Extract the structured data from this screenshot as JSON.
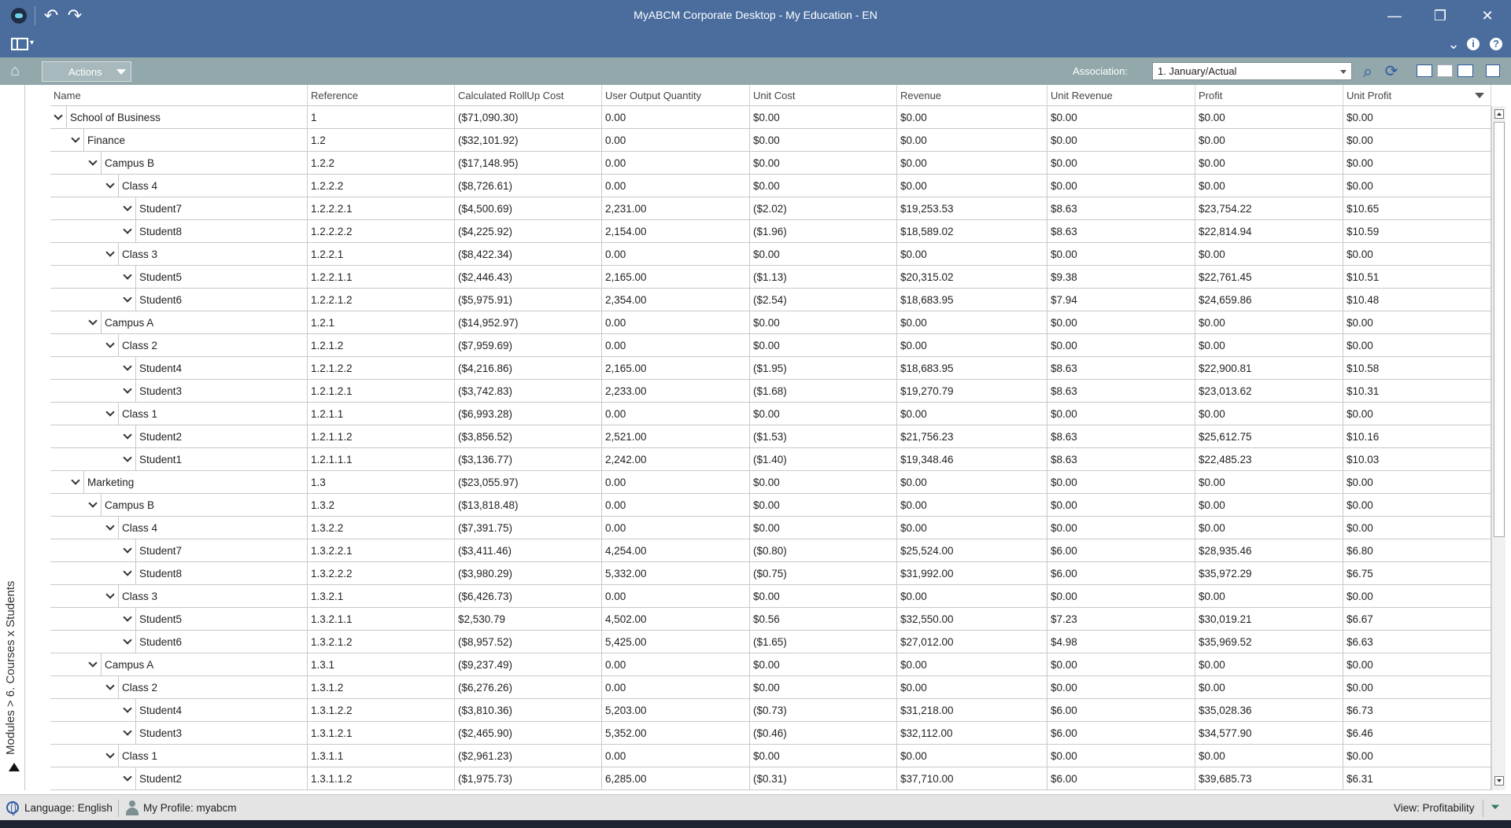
{
  "window": {
    "title": "MyABCM Corporate Desktop - My Education - EN",
    "minimize_glyph": "—",
    "restore_glyph": "❐",
    "close_glyph": "✕",
    "undo_glyph": "↶",
    "redo_glyph": "↷"
  },
  "ribbon": {
    "dropdown_glyph": "▾",
    "collapse_glyph": "⌄",
    "info_glyph": "i",
    "help_glyph": "?"
  },
  "toolbar": {
    "home_glyph": "⌂",
    "actions_label": "Actions",
    "association_label": "Association:",
    "association_value": "1. January/Actual",
    "search_glyph": "⌕",
    "refresh_glyph": "⟳"
  },
  "side_panel": {
    "breadcrumb": "Modules > 6. Courses x Students"
  },
  "grid": {
    "columns": [
      "Name",
      "Reference",
      "Calculated RollUp Cost",
      "User Output Quantity",
      "Unit Cost",
      "Revenue",
      "Unit Revenue",
      "Profit",
      "Unit Profit"
    ],
    "rows": [
      {
        "level": 0,
        "name": "School of Business",
        "ref": "1",
        "cost": "($71,090.30)",
        "qty": "0.00",
        "unit_cost": "$0.00",
        "revenue": "$0.00",
        "unit_revenue": "$0.00",
        "profit": "$0.00",
        "unit_profit": "$0.00"
      },
      {
        "level": 1,
        "name": "Finance",
        "ref": "1.2",
        "cost": "($32,101.92)",
        "qty": "0.00",
        "unit_cost": "$0.00",
        "revenue": "$0.00",
        "unit_revenue": "$0.00",
        "profit": "$0.00",
        "unit_profit": "$0.00"
      },
      {
        "level": 2,
        "name": "Campus B",
        "ref": "1.2.2",
        "cost": "($17,148.95)",
        "qty": "0.00",
        "unit_cost": "$0.00",
        "revenue": "$0.00",
        "unit_revenue": "$0.00",
        "profit": "$0.00",
        "unit_profit": "$0.00"
      },
      {
        "level": 3,
        "name": "Class 4",
        "ref": "1.2.2.2",
        "cost": "($8,726.61)",
        "qty": "0.00",
        "unit_cost": "$0.00",
        "revenue": "$0.00",
        "unit_revenue": "$0.00",
        "profit": "$0.00",
        "unit_profit": "$0.00"
      },
      {
        "level": 4,
        "name": "Student7",
        "ref": "1.2.2.2.1",
        "cost": "($4,500.69)",
        "qty": "2,231.00",
        "unit_cost": "($2.02)",
        "revenue": "$19,253.53",
        "unit_revenue": "$8.63",
        "profit": "$23,754.22",
        "unit_profit": "$10.65"
      },
      {
        "level": 4,
        "name": "Student8",
        "ref": "1.2.2.2.2",
        "cost": "($4,225.92)",
        "qty": "2,154.00",
        "unit_cost": "($1.96)",
        "revenue": "$18,589.02",
        "unit_revenue": "$8.63",
        "profit": "$22,814.94",
        "unit_profit": "$10.59"
      },
      {
        "level": 3,
        "name": "Class 3",
        "ref": "1.2.2.1",
        "cost": "($8,422.34)",
        "qty": "0.00",
        "unit_cost": "$0.00",
        "revenue": "$0.00",
        "unit_revenue": "$0.00",
        "profit": "$0.00",
        "unit_profit": "$0.00"
      },
      {
        "level": 4,
        "name": "Student5",
        "ref": "1.2.2.1.1",
        "cost": "($2,446.43)",
        "qty": "2,165.00",
        "unit_cost": "($1.13)",
        "revenue": "$20,315.02",
        "unit_revenue": "$9.38",
        "profit": "$22,761.45",
        "unit_profit": "$10.51"
      },
      {
        "level": 4,
        "name": "Student6",
        "ref": "1.2.2.1.2",
        "cost": "($5,975.91)",
        "qty": "2,354.00",
        "unit_cost": "($2.54)",
        "revenue": "$18,683.95",
        "unit_revenue": "$7.94",
        "profit": "$24,659.86",
        "unit_profit": "$10.48"
      },
      {
        "level": 2,
        "name": "Campus A",
        "ref": "1.2.1",
        "cost": "($14,952.97)",
        "qty": "0.00",
        "unit_cost": "$0.00",
        "revenue": "$0.00",
        "unit_revenue": "$0.00",
        "profit": "$0.00",
        "unit_profit": "$0.00"
      },
      {
        "level": 3,
        "name": "Class 2",
        "ref": "1.2.1.2",
        "cost": "($7,959.69)",
        "qty": "0.00",
        "unit_cost": "$0.00",
        "revenue": "$0.00",
        "unit_revenue": "$0.00",
        "profit": "$0.00",
        "unit_profit": "$0.00"
      },
      {
        "level": 4,
        "name": "Student4",
        "ref": "1.2.1.2.2",
        "cost": "($4,216.86)",
        "qty": "2,165.00",
        "unit_cost": "($1.95)",
        "revenue": "$18,683.95",
        "unit_revenue": "$8.63",
        "profit": "$22,900.81",
        "unit_profit": "$10.58"
      },
      {
        "level": 4,
        "name": "Student3",
        "ref": "1.2.1.2.1",
        "cost": "($3,742.83)",
        "qty": "2,233.00",
        "unit_cost": "($1.68)",
        "revenue": "$19,270.79",
        "unit_revenue": "$8.63",
        "profit": "$23,013.62",
        "unit_profit": "$10.31"
      },
      {
        "level": 3,
        "name": "Class 1",
        "ref": "1.2.1.1",
        "cost": "($6,993.28)",
        "qty": "0.00",
        "unit_cost": "$0.00",
        "revenue": "$0.00",
        "unit_revenue": "$0.00",
        "profit": "$0.00",
        "unit_profit": "$0.00"
      },
      {
        "level": 4,
        "name": "Student2",
        "ref": "1.2.1.1.2",
        "cost": "($3,856.52)",
        "qty": "2,521.00",
        "unit_cost": "($1.53)",
        "revenue": "$21,756.23",
        "unit_revenue": "$8.63",
        "profit": "$25,612.75",
        "unit_profit": "$10.16"
      },
      {
        "level": 4,
        "name": "Student1",
        "ref": "1.2.1.1.1",
        "cost": "($3,136.77)",
        "qty": "2,242.00",
        "unit_cost": "($1.40)",
        "revenue": "$19,348.46",
        "unit_revenue": "$8.63",
        "profit": "$22,485.23",
        "unit_profit": "$10.03"
      },
      {
        "level": 1,
        "name": "Marketing",
        "ref": "1.3",
        "cost": "($23,055.97)",
        "qty": "0.00",
        "unit_cost": "$0.00",
        "revenue": "$0.00",
        "unit_revenue": "$0.00",
        "profit": "$0.00",
        "unit_profit": "$0.00"
      },
      {
        "level": 2,
        "name": "Campus B",
        "ref": "1.3.2",
        "cost": "($13,818.48)",
        "qty": "0.00",
        "unit_cost": "$0.00",
        "revenue": "$0.00",
        "unit_revenue": "$0.00",
        "profit": "$0.00",
        "unit_profit": "$0.00"
      },
      {
        "level": 3,
        "name": "Class 4",
        "ref": "1.3.2.2",
        "cost": "($7,391.75)",
        "qty": "0.00",
        "unit_cost": "$0.00",
        "revenue": "$0.00",
        "unit_revenue": "$0.00",
        "profit": "$0.00",
        "unit_profit": "$0.00"
      },
      {
        "level": 4,
        "name": "Student7",
        "ref": "1.3.2.2.1",
        "cost": "($3,411.46)",
        "qty": "4,254.00",
        "unit_cost": "($0.80)",
        "revenue": "$25,524.00",
        "unit_revenue": "$6.00",
        "profit": "$28,935.46",
        "unit_profit": "$6.80"
      },
      {
        "level": 4,
        "name": "Student8",
        "ref": "1.3.2.2.2",
        "cost": "($3,980.29)",
        "qty": "5,332.00",
        "unit_cost": "($0.75)",
        "revenue": "$31,992.00",
        "unit_revenue": "$6.00",
        "profit": "$35,972.29",
        "unit_profit": "$6.75"
      },
      {
        "level": 3,
        "name": "Class 3",
        "ref": "1.3.2.1",
        "cost": "($6,426.73)",
        "qty": "0.00",
        "unit_cost": "$0.00",
        "revenue": "$0.00",
        "unit_revenue": "$0.00",
        "profit": "$0.00",
        "unit_profit": "$0.00"
      },
      {
        "level": 4,
        "name": "Student5",
        "ref": "1.3.2.1.1",
        "cost": "$2,530.79",
        "qty": "4,502.00",
        "unit_cost": "$0.56",
        "revenue": "$32,550.00",
        "unit_revenue": "$7.23",
        "profit": "$30,019.21",
        "unit_profit": "$6.67"
      },
      {
        "level": 4,
        "name": "Student6",
        "ref": "1.3.2.1.2",
        "cost": "($8,957.52)",
        "qty": "5,425.00",
        "unit_cost": "($1.65)",
        "revenue": "$27,012.00",
        "unit_revenue": "$4.98",
        "profit": "$35,969.52",
        "unit_profit": "$6.63"
      },
      {
        "level": 2,
        "name": "Campus A",
        "ref": "1.3.1",
        "cost": "($9,237.49)",
        "qty": "0.00",
        "unit_cost": "$0.00",
        "revenue": "$0.00",
        "unit_revenue": "$0.00",
        "profit": "$0.00",
        "unit_profit": "$0.00"
      },
      {
        "level": 3,
        "name": "Class 2",
        "ref": "1.3.1.2",
        "cost": "($6,276.26)",
        "qty": "0.00",
        "unit_cost": "$0.00",
        "revenue": "$0.00",
        "unit_revenue": "$0.00",
        "profit": "$0.00",
        "unit_profit": "$0.00"
      },
      {
        "level": 4,
        "name": "Student4",
        "ref": "1.3.1.2.2",
        "cost": "($3,810.36)",
        "qty": "5,203.00",
        "unit_cost": "($0.73)",
        "revenue": "$31,218.00",
        "unit_revenue": "$6.00",
        "profit": "$35,028.36",
        "unit_profit": "$6.73"
      },
      {
        "level": 4,
        "name": "Student3",
        "ref": "1.3.1.2.1",
        "cost": "($2,465.90)",
        "qty": "5,352.00",
        "unit_cost": "($0.46)",
        "revenue": "$32,112.00",
        "unit_revenue": "$6.00",
        "profit": "$34,577.90",
        "unit_profit": "$6.46"
      },
      {
        "level": 3,
        "name": "Class 1",
        "ref": "1.3.1.1",
        "cost": "($2,961.23)",
        "qty": "0.00",
        "unit_cost": "$0.00",
        "revenue": "$0.00",
        "unit_revenue": "$0.00",
        "profit": "$0.00",
        "unit_profit": "$0.00"
      },
      {
        "level": 4,
        "name": "Student2",
        "ref": "1.3.1.1.2",
        "cost": "($1,975.73)",
        "qty": "6,285.00",
        "unit_cost": "($0.31)",
        "revenue": "$37,710.00",
        "unit_revenue": "$6.00",
        "profit": "$39,685.73",
        "unit_profit": "$6.31"
      }
    ]
  },
  "status_bar": {
    "language": "Language: English",
    "profile": "My Profile: myabcm",
    "view": "View: Profitability",
    "filter_glyph": "⏷"
  },
  "colors": {
    "titlebar": "#4a6d9e",
    "toolbar": "#93a8ab",
    "accent": "#2c5aa0"
  }
}
